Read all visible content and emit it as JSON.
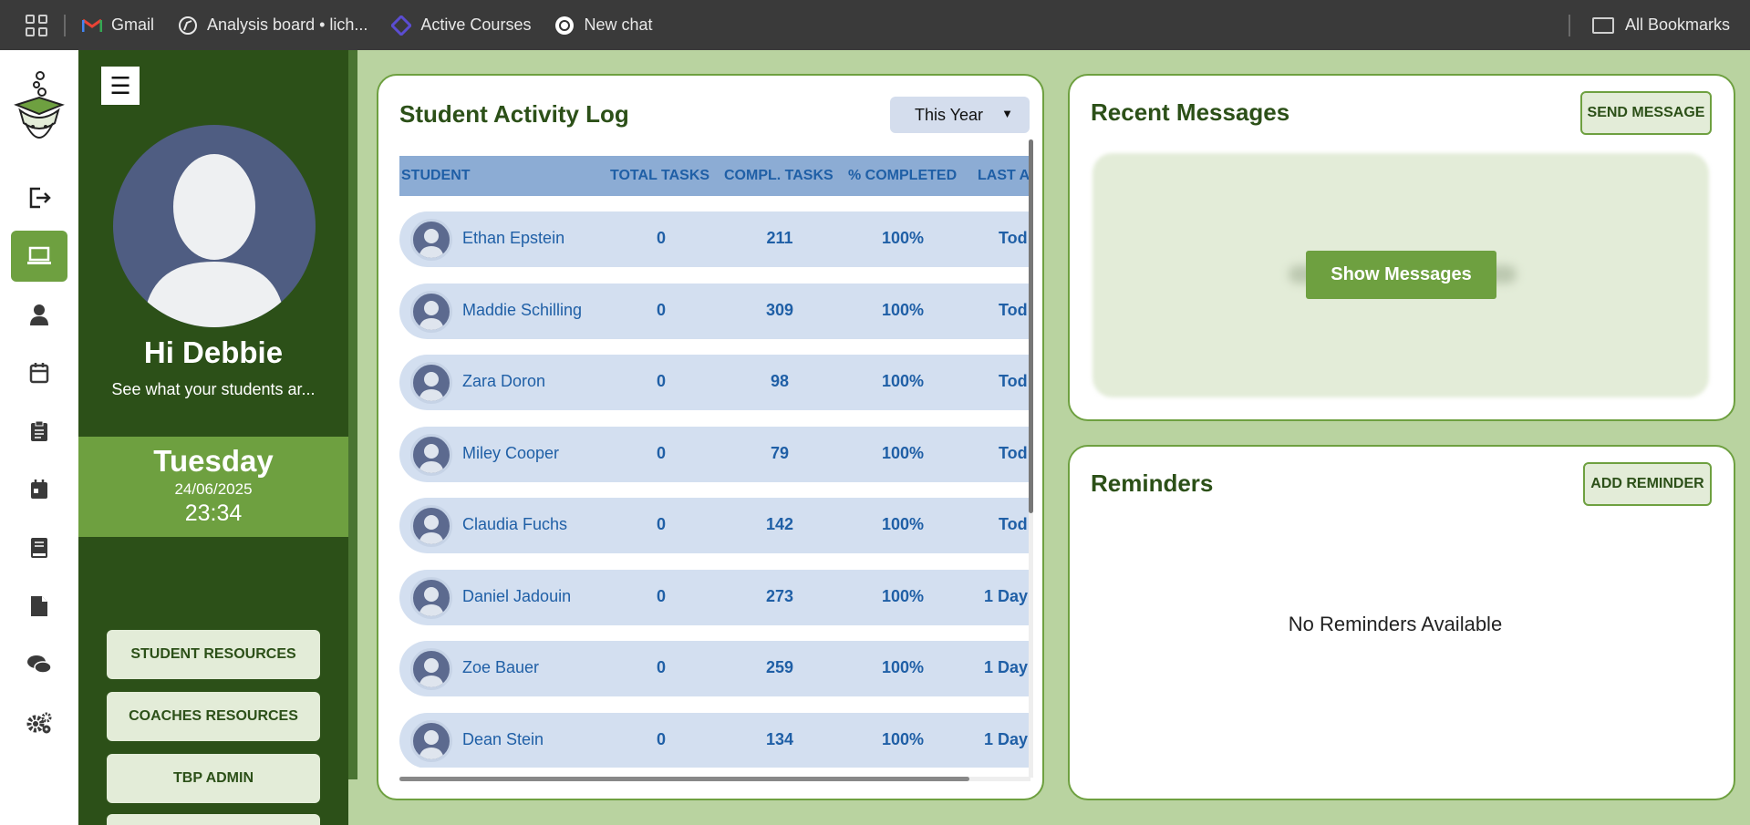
{
  "bookmarks": {
    "items": [
      {
        "label": "Gmail",
        "icon": "gmail-icon"
      },
      {
        "label": "Analysis board • lich...",
        "icon": "lichess-icon"
      },
      {
        "label": "Active Courses",
        "icon": "courses-icon"
      },
      {
        "label": "New chat",
        "icon": "chatgpt-icon"
      }
    ],
    "all_bookmarks": "All Bookmarks"
  },
  "rail": {
    "items": [
      "logout-icon",
      "laptop-icon",
      "user-icon",
      "calendar-icon",
      "clipboard-icon",
      "calendar-filled-icon",
      "book-icon",
      "document-icon",
      "chat-icon",
      "settings-icon"
    ],
    "active": "laptop-icon"
  },
  "sidebar": {
    "greeting": "Hi Debbie",
    "subtitle": "See what your students ar...",
    "day": "Tuesday",
    "date": "24/06/2025",
    "time": "23:34",
    "buttons": [
      "STUDENT RESOURCES",
      "COACHES RESOURCES",
      "TBP ADMIN"
    ]
  },
  "activity": {
    "title": "Student Activity Log",
    "filter": "This Year",
    "columns": [
      "STUDENT",
      "TOTAL TASKS",
      "COMPL. TASKS",
      "% COMPLETED",
      "LAST AC"
    ],
    "rows": [
      {
        "name": "Ethan Epstein",
        "total": "0",
        "completed": "211",
        "percent": "100%",
        "last": "Tod"
      },
      {
        "name": "Maddie Schilling",
        "total": "0",
        "completed": "309",
        "percent": "100%",
        "last": "Tod"
      },
      {
        "name": "Zara Doron",
        "total": "0",
        "completed": "98",
        "percent": "100%",
        "last": "Tod"
      },
      {
        "name": "Miley Cooper",
        "total": "0",
        "completed": "79",
        "percent": "100%",
        "last": "Tod"
      },
      {
        "name": "Claudia Fuchs",
        "total": "0",
        "completed": "142",
        "percent": "100%",
        "last": "Tod"
      },
      {
        "name": "Daniel Jadouin",
        "total": "0",
        "completed": "273",
        "percent": "100%",
        "last": "1 Day"
      },
      {
        "name": "Zoe Bauer",
        "total": "0",
        "completed": "259",
        "percent": "100%",
        "last": "1 Day"
      },
      {
        "name": "Dean Stein",
        "total": "0",
        "completed": "134",
        "percent": "100%",
        "last": "1 Day"
      }
    ]
  },
  "messages": {
    "title": "Recent Messages",
    "send_label": "SEND MESSAGE",
    "show_label": "Show Messages"
  },
  "reminders": {
    "title": "Reminders",
    "add_label": "ADD REMINDER",
    "empty": "No Reminders Available"
  },
  "colors": {
    "brand_dark": "#2c5018",
    "brand_green": "#6ea040",
    "page_bg": "#b9d3a0",
    "table_text": "#1f5fa6"
  }
}
